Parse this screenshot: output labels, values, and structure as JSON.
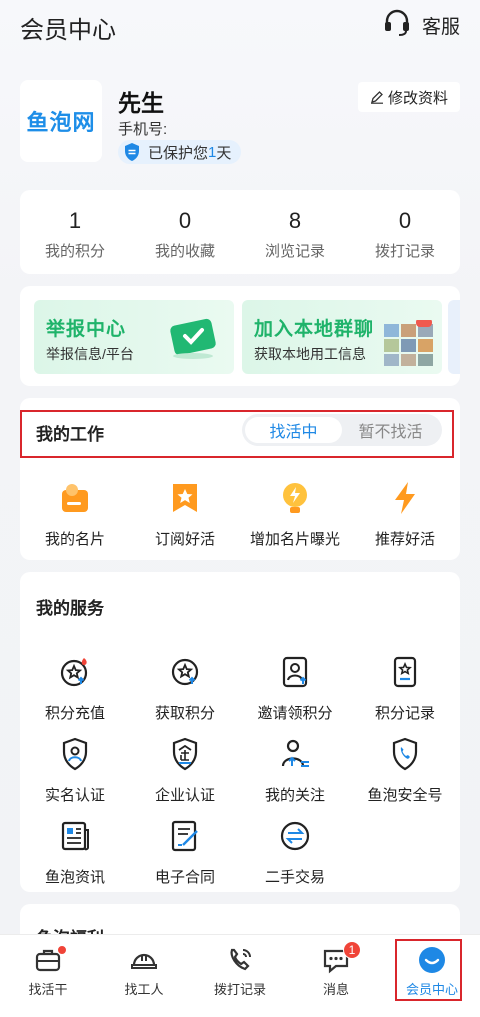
{
  "header": {
    "title": "会员中心",
    "service_label": "客服"
  },
  "profile": {
    "logo_text": "鱼泡网",
    "name": "先生",
    "phone_label": "手机号:",
    "protect_prefix": "已保护您",
    "protect_days": "1",
    "protect_suffix": "天",
    "edit_label": "修改资料"
  },
  "stats": [
    {
      "value": "1",
      "label": "我的积分"
    },
    {
      "value": "0",
      "label": "我的收藏"
    },
    {
      "value": "8",
      "label": "浏览记录"
    },
    {
      "value": "0",
      "label": "拨打记录"
    }
  ],
  "banners": [
    {
      "title": "举报中心",
      "subtitle": "举报信息/平台"
    },
    {
      "title": "加入本地群聊",
      "subtitle": "获取本地用工信息"
    }
  ],
  "work": {
    "title": "我的工作",
    "status_options": [
      "找活中",
      "暂不找活"
    ],
    "selected": "找活中",
    "items": [
      {
        "label": "我的名片",
        "icon": "id-card-icon"
      },
      {
        "label": "订阅好活",
        "icon": "star-ribbon-icon"
      },
      {
        "label": "增加名片曝光",
        "icon": "lightning-bulb-icon"
      },
      {
        "label": "推荐好活",
        "icon": "lightning-icon"
      }
    ]
  },
  "services": {
    "title": "我的服务",
    "items": [
      {
        "label": "积分充值",
        "icon": "points-recharge-icon"
      },
      {
        "label": "获取积分",
        "icon": "get-points-icon"
      },
      {
        "label": "邀请领积分",
        "icon": "invite-icon"
      },
      {
        "label": "积分记录",
        "icon": "points-record-icon"
      },
      {
        "label": "实名认证",
        "icon": "real-name-shield-icon"
      },
      {
        "label": "企业认证",
        "icon": "enterprise-shield-icon"
      },
      {
        "label": "我的关注",
        "icon": "follow-person-icon"
      },
      {
        "label": "鱼泡安全号",
        "icon": "phone-shield-icon"
      },
      {
        "label": "鱼泡资讯",
        "icon": "news-icon"
      },
      {
        "label": "电子合同",
        "icon": "contract-icon"
      },
      {
        "label": "二手交易",
        "icon": "exchange-icon"
      }
    ]
  },
  "welfare": {
    "title": "鱼泡福利"
  },
  "tabbar": [
    {
      "label": "找活干",
      "icon": "briefcase-icon"
    },
    {
      "label": "找工人",
      "icon": "helmet-icon"
    },
    {
      "label": "拨打记录",
      "icon": "phone-icon"
    },
    {
      "label": "消息",
      "icon": "message-icon",
      "badge": "1"
    },
    {
      "label": "会员中心",
      "icon": "member-icon",
      "active": true
    }
  ],
  "colors": {
    "accent": "#1e88e5",
    "green": "#1fb36a",
    "orange": "#ff9a1f",
    "highlight": "#d9262c"
  }
}
